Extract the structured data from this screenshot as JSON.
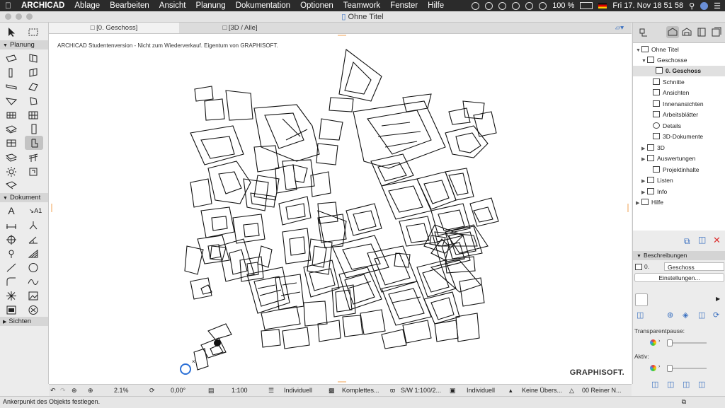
{
  "menubar": {
    "apple": "",
    "app": "ARCHICAD",
    "items": [
      "Ablage",
      "Bearbeiten",
      "Ansicht",
      "Planung",
      "Dokumentation",
      "Optionen",
      "Teamwork",
      "Fenster",
      "Hilfe"
    ],
    "battery": "100 %",
    "clock": "Fri 17. Nov  18 51 58"
  },
  "window": {
    "title": "Ohne Titel"
  },
  "toolbox": {
    "sections": {
      "planung": "Planung",
      "dokument": "Dokument",
      "sichten": "Sichten"
    },
    "dim_label": "A1"
  },
  "tabs": [
    {
      "label": "[0. Geschoss]"
    },
    {
      "label": "[3D / Alle]"
    }
  ],
  "canvas": {
    "watermark": "ARCHICAD Studentenversion - Nicht zum Wiederverkauf. Eigentum von GRAPHISOFT.",
    "logo": "GRAPHISOFT."
  },
  "statusbar": {
    "zoom": "2.1%",
    "angle": "0,00°",
    "scale": "1:100",
    "layers": "Individuell",
    "model": "Komplettes...",
    "pen": "S/W 1:100/2...",
    "display": "Individuell",
    "override": "Keine Übers...",
    "renovation": "00 Reiner N..."
  },
  "hint": "Ankerpunkt des Objekts festlegen.",
  "navigator": {
    "tree": [
      {
        "label": "Ohne Titel",
        "level": 0,
        "arrow": "down",
        "icon": "project-icon"
      },
      {
        "label": "Geschosse",
        "level": 1,
        "arrow": "down",
        "icon": "folder-icon"
      },
      {
        "label": "0. Geschoss",
        "level": 2,
        "arrow": "",
        "icon": "story-icon",
        "selected": true
      },
      {
        "label": "Schnitte",
        "level": 1,
        "arrow": "",
        "icon": "section-icon"
      },
      {
        "label": "Ansichten",
        "level": 1,
        "arrow": "",
        "icon": "elevation-icon"
      },
      {
        "label": "Innenansichten",
        "level": 1,
        "arrow": "",
        "icon": "interior-icon"
      },
      {
        "label": "Arbeitsblätter",
        "level": 1,
        "arrow": "",
        "icon": "worksheet-icon"
      },
      {
        "label": "Details",
        "level": 1,
        "arrow": "",
        "icon": "detail-icon"
      },
      {
        "label": "3D-Dokumente",
        "level": 1,
        "arrow": "",
        "icon": "3d-document-icon"
      },
      {
        "label": "3D",
        "level": 1,
        "arrow": "right",
        "icon": "3d-icon"
      },
      {
        "label": "Auswertungen",
        "level": 1,
        "arrow": "right",
        "icon": "schedule-icon"
      },
      {
        "label": "Projektinhalte",
        "level": 1,
        "arrow": "",
        "icon": "index-icon"
      },
      {
        "label": "Listen",
        "level": 1,
        "arrow": "right",
        "icon": "list-icon"
      },
      {
        "label": "Info",
        "level": 1,
        "arrow": "right",
        "icon": "info-icon"
      },
      {
        "label": "Hilfe",
        "level": 0,
        "arrow": "right",
        "icon": "help-icon"
      }
    ],
    "props": {
      "head": "Beschreibungen",
      "id": "0.",
      "name": "Geschoss",
      "settings": "Einstellungen...",
      "transparent_label": "Transparentpause:",
      "active_label": "Aktiv:"
    }
  }
}
